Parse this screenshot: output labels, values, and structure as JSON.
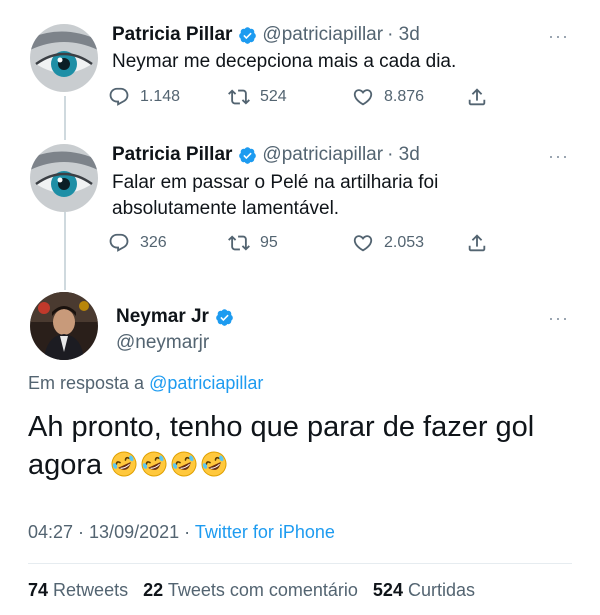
{
  "tweets": [
    {
      "author": "Patricia Pillar",
      "handle": "@patriciapillar",
      "age": "· 3d",
      "text_lines": [
        "Neymar me decepciona mais a cada dia."
      ],
      "replies": "1.148",
      "retweets": "524",
      "likes": "8.876"
    },
    {
      "author": "Patricia Pillar",
      "handle": "@patriciapillar",
      "age": "· 3d",
      "text_lines": [
        "Falar em passar o Pelé na artilharia foi",
        "absolutamente lamentável."
      ],
      "replies": "326",
      "retweets": "95",
      "likes": "2.053"
    }
  ],
  "main_tweet": {
    "author": "Neymar Jr",
    "handle": "@neymarjr",
    "reply_prefix": "Em resposta a",
    "reply_mention": "@patriciapillar",
    "text_line1": "Ah pronto, tenho que parar de fazer gol",
    "text_line2": "agora",
    "emoji_count": 4,
    "time": "04:27 · 13/09/2021 ·",
    "source": "Twitter for iPhone",
    "stats": {
      "retweets": "74",
      "retweets_label": "Retweets",
      "quotes": "22",
      "quotes_label": "Tweets com comentário",
      "likes": "524",
      "likes_label": "Curtidas"
    }
  },
  "icons": {
    "more": "more-options-icon",
    "verified": "verified-badge-icon",
    "reply": "reply-icon",
    "retweet": "retweet-icon",
    "like": "like-icon",
    "share": "share-icon",
    "emoji": "rofl-emoji-icon"
  },
  "colors": {
    "accent": "#1d9bf0",
    "text": "#0f1419",
    "secondary": "#536471"
  }
}
